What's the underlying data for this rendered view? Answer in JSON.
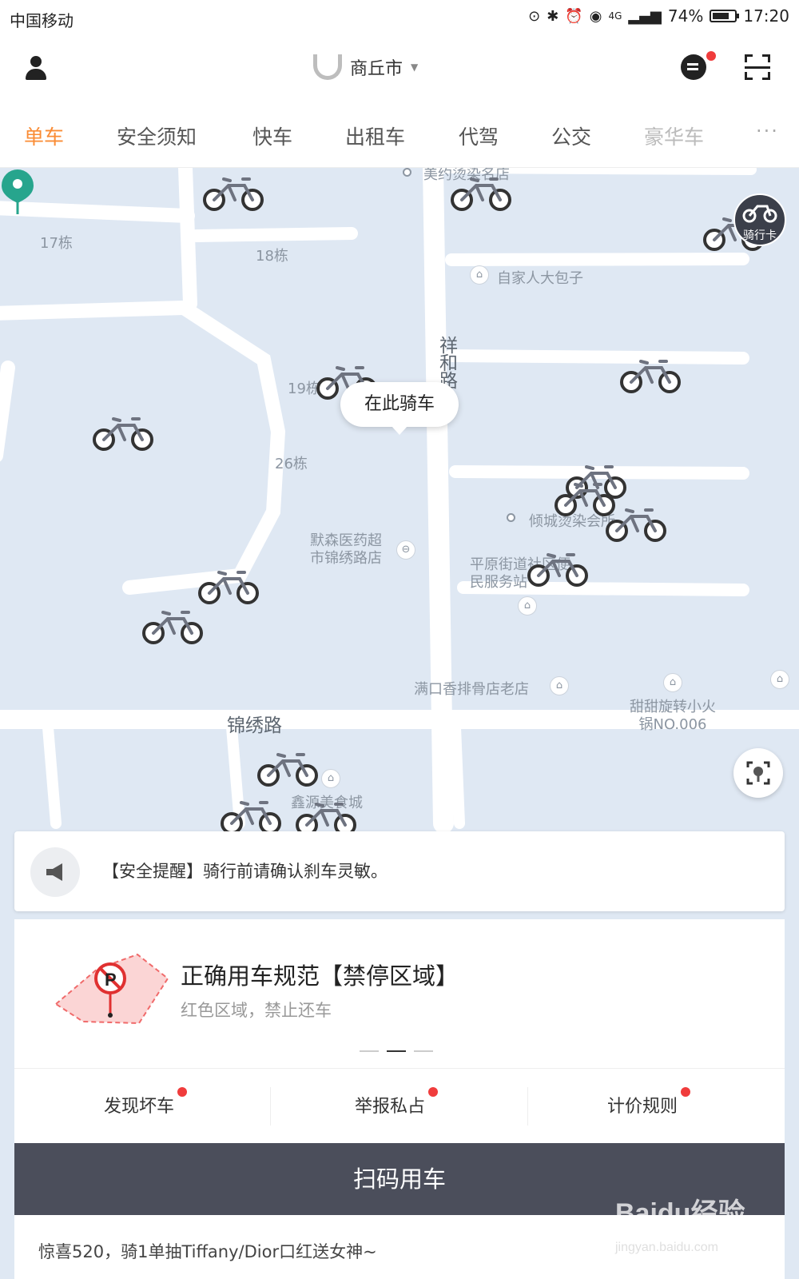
{
  "status": {
    "carrier": "中国移动",
    "network": "4G",
    "battery": "74%",
    "time": "17:20"
  },
  "header": {
    "city": "商丘市",
    "icons": [
      "user-icon",
      "message-icon",
      "scan-icon"
    ]
  },
  "tabs": [
    {
      "label": "单车",
      "active": true
    },
    {
      "label": "安全须知"
    },
    {
      "label": "快车"
    },
    {
      "label": "出租车"
    },
    {
      "label": "代驾"
    },
    {
      "label": "公交"
    },
    {
      "label": "豪华车"
    },
    {
      "label": "···"
    }
  ],
  "map": {
    "labels": {
      "b17": "17栋",
      "b18": "18栋",
      "b19": "19栋",
      "b26": "26栋",
      "shop_top": "美约烫染名店",
      "baozi": "自家人大包子",
      "road_xh": "祥和路",
      "qingcheng": "倾城烫染会所",
      "pharmacy": "默森医药超市锦绣路店",
      "pingyuan": "平原街道社区便民服务站",
      "paigu": "满口香排骨店老店",
      "hotpot": "甜甜旋转小火锅NO.006",
      "road_jx": "锦绣路",
      "xinyuan": "鑫源美食城"
    },
    "bubble": "在此骑车",
    "ride_card": "骑行卡",
    "accent": "#27a58d"
  },
  "notice": {
    "text": "【安全提醒】骑行前请确认刹车灵敏。",
    "icon": "megaphone-icon"
  },
  "banner": {
    "title": "正确用车规范【禁停区域】",
    "subtitle": "红色区域，禁止还车",
    "page": 2,
    "pages": 3
  },
  "actions": [
    {
      "label": "发现坏车",
      "badge": true
    },
    {
      "label": "举报私占",
      "badge": true
    },
    {
      "label": "计价规则",
      "badge": true
    }
  ],
  "scan_button": "扫码用车",
  "promo": "惊喜520，骑1单抽Tiffany/Dior口红送女神~",
  "watermark": {
    "brand": "Baidu经验",
    "url": "jingyan.baidu.com"
  },
  "colors": {
    "accent_orange": "#fa8c35",
    "badge_red": "#f03c3c",
    "button_dark": "#4b4e5b"
  }
}
